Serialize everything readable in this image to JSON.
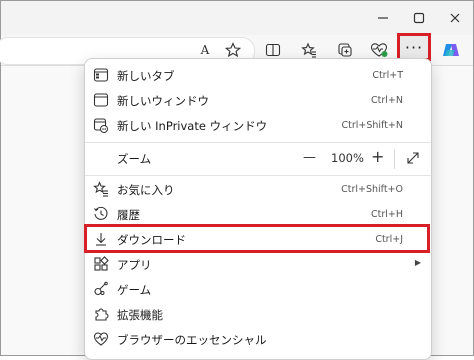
{
  "window": {
    "minimize_icon": "minimize-icon",
    "maximize_icon": "maximize-icon"
  },
  "toolbar": {
    "read_aloud_label": "A",
    "more_label": "···"
  },
  "menu": {
    "items": [
      {
        "label": "新しいタブ",
        "shortcut": "Ctrl+T"
      },
      {
        "label": "新しいウィンドウ",
        "shortcut": "Ctrl+N"
      },
      {
        "label": "新しい InPrivate ウィンドウ",
        "shortcut": "Ctrl+Shift+N"
      },
      {
        "label": "ズーム",
        "shortcut": ""
      },
      {
        "label": "お気に入り",
        "shortcut": "Ctrl+Shift+O"
      },
      {
        "label": "履歴",
        "shortcut": "Ctrl+H"
      },
      {
        "label": "ダウンロード",
        "shortcut": "Ctrl+J"
      },
      {
        "label": "アプリ",
        "shortcut": ""
      },
      {
        "label": "ゲーム",
        "shortcut": ""
      },
      {
        "label": "拡張機能",
        "shortcut": ""
      },
      {
        "label": "ブラウザーのエッセンシャル",
        "shortcut": ""
      }
    ],
    "zoom": {
      "minus": "—",
      "value": "100%",
      "plus": "+"
    }
  },
  "colors": {
    "highlight": "#d61f26",
    "copilot": "#1f8fe8"
  }
}
